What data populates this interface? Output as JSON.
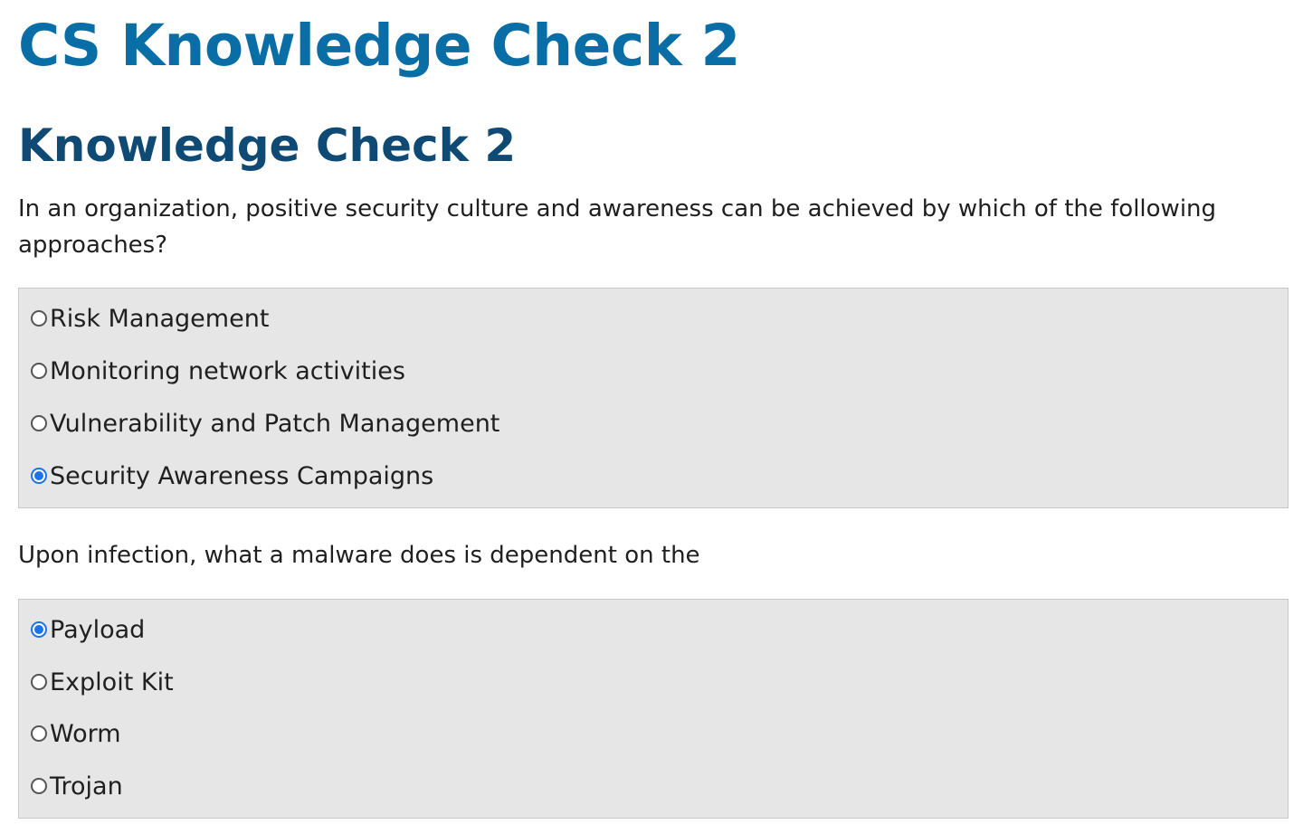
{
  "page": {
    "title": "CS Knowledge Check 2",
    "section_title": "Knowledge Check 2"
  },
  "colors": {
    "title": "#0a6ea6",
    "section_title": "#0e4a73",
    "options_bg": "#e6e6e6",
    "radio_checked": "#1a73e8"
  },
  "questions": [
    {
      "text": "In an organization, positive security culture and awareness can be achieved by which of the following approaches?",
      "selected": "Security Awareness Campaigns",
      "options": [
        {
          "label": "Risk Management",
          "checked": false
        },
        {
          "label": "Monitoring network activities",
          "checked": false
        },
        {
          "label": "Vulnerability and Patch Management",
          "checked": false
        },
        {
          "label": "Security Awareness Campaigns",
          "checked": true
        }
      ]
    },
    {
      "text": "Upon infection, what a malware does is dependent on the",
      "selected": "Payload",
      "options": [
        {
          "label": "Payload",
          "checked": true
        },
        {
          "label": "Exploit Kit",
          "checked": false
        },
        {
          "label": "Worm",
          "checked": false
        },
        {
          "label": "Trojan",
          "checked": false
        }
      ]
    }
  ]
}
